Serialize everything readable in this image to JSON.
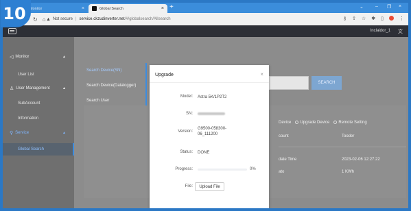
{
  "step_badge": "10",
  "browser": {
    "tabs": [
      {
        "title": "Monitor"
      },
      {
        "title": "Global Search"
      }
    ],
    "address": {
      "security": "Not secure",
      "host": "service.ckzudinverter.net",
      "path": "/#/globalsearch/Allsearch"
    }
  },
  "header": {
    "username": "Inclaidor_1"
  },
  "sidebar": {
    "items": [
      {
        "label": "Monitor"
      },
      {
        "label": "User List"
      },
      {
        "label": "User Management"
      },
      {
        "label": "SubAccount"
      },
      {
        "label": "Information"
      },
      {
        "label": "Service"
      },
      {
        "label": "Global Search"
      }
    ]
  },
  "content": {
    "vtabs": [
      {
        "label": "Search Device(SN)"
      },
      {
        "label": "Search Device(Datalogger)"
      },
      {
        "label": "Search User"
      }
    ],
    "search_button": "SEARCH",
    "radios": [
      {
        "label": "Device"
      },
      {
        "label": "Upgrade Device"
      },
      {
        "label": "Remote Setting"
      }
    ],
    "rows": [
      {
        "label": "count",
        "value": "Tooder"
      },
      {
        "label": "date Time",
        "value": "2023-02-06 12:27:22"
      },
      {
        "label": "ato",
        "value": "1 KWh"
      }
    ]
  },
  "modal": {
    "title": "Upgrade",
    "fields": {
      "model": {
        "label": "Model:",
        "value": "Astra 5K/1P2T2"
      },
      "sn": {
        "label": "SN:"
      },
      "version": {
        "label": "Version:",
        "value": "G9500-058300-06_111200"
      },
      "status": {
        "label": "Status:",
        "value": "DONE"
      },
      "progress": {
        "label": "Progress:",
        "value": 0,
        "text": "0%"
      },
      "file": {
        "label": "File:",
        "button": "Upload File"
      }
    }
  },
  "colors": {
    "accent": "#3d8de0",
    "tabbar": "#3b8ddb",
    "app_header": "#2d2f36"
  }
}
